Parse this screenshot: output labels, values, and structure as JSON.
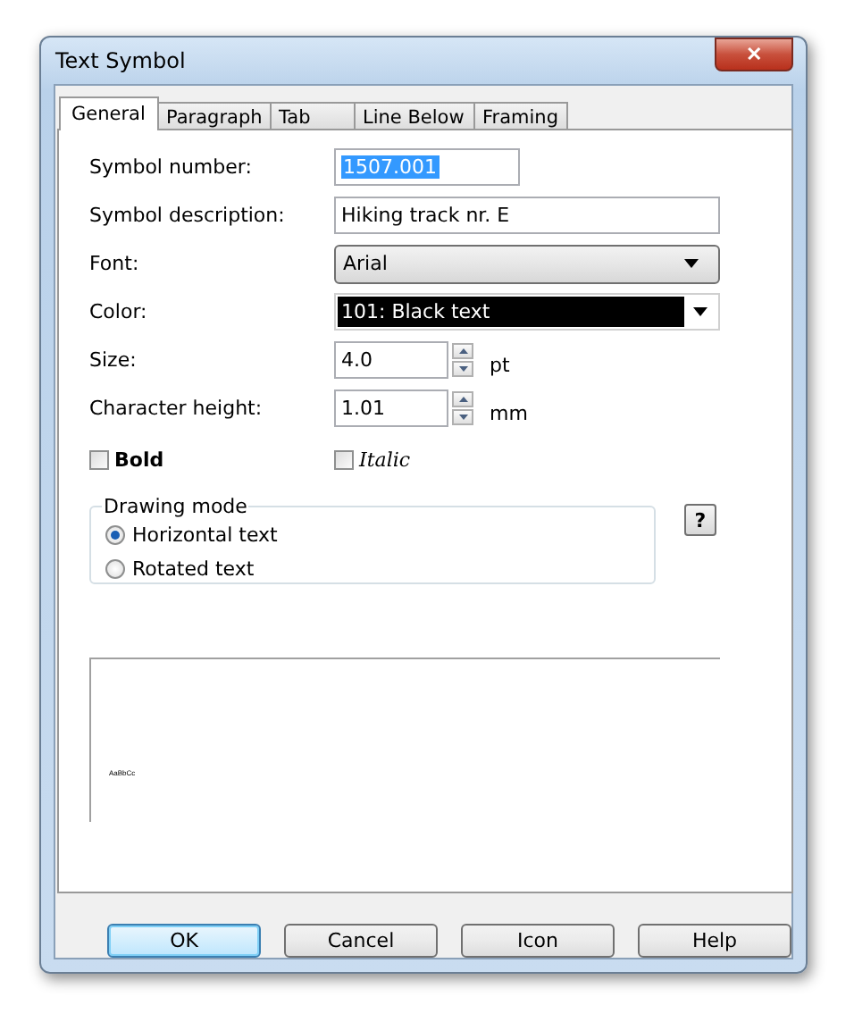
{
  "window": {
    "title": "Text Symbol",
    "close": "✕"
  },
  "tabs": [
    {
      "label": "General",
      "selected": true
    },
    {
      "label": "Paragraph",
      "selected": false
    },
    {
      "label": "Tab",
      "selected": false
    },
    {
      "label": "Line Below",
      "selected": false
    },
    {
      "label": "Framing",
      "selected": false
    }
  ],
  "fields": [
    {
      "kind": "text",
      "label": "Symbol number:",
      "value": "1507.001",
      "selected": true
    },
    {
      "kind": "text",
      "label": "Symbol description:",
      "value": "Hiking track nr. E",
      "selected": false
    },
    {
      "kind": "dropdown",
      "label": "Font:",
      "value": "Arial"
    },
    {
      "kind": "color",
      "label": "Color:",
      "value": "101: Black text",
      "color": "#000000"
    },
    {
      "kind": "spin",
      "label": "Size:",
      "value": "4.0",
      "unit": "pt"
    },
    {
      "kind": "spin",
      "label": "Character height:",
      "value": "1.01",
      "unit": "mm"
    }
  ],
  "checkboxes": [
    {
      "label": "Bold",
      "kind": "bold",
      "checked": false
    },
    {
      "label": "Italic",
      "kind": "italic",
      "checked": false
    }
  ],
  "drawing_mode": {
    "title": "Drawing mode",
    "options": [
      {
        "label": "Horizontal text",
        "selected": true
      },
      {
        "label": "Rotated text",
        "selected": false
      }
    ]
  },
  "help_button": "?",
  "preview": {
    "sample": "AaBbCc"
  },
  "buttons": [
    {
      "label": "OK",
      "default": true
    },
    {
      "label": "Cancel",
      "default": false
    },
    {
      "label": "Icon",
      "default": false
    },
    {
      "label": "Help",
      "default": false
    }
  ]
}
